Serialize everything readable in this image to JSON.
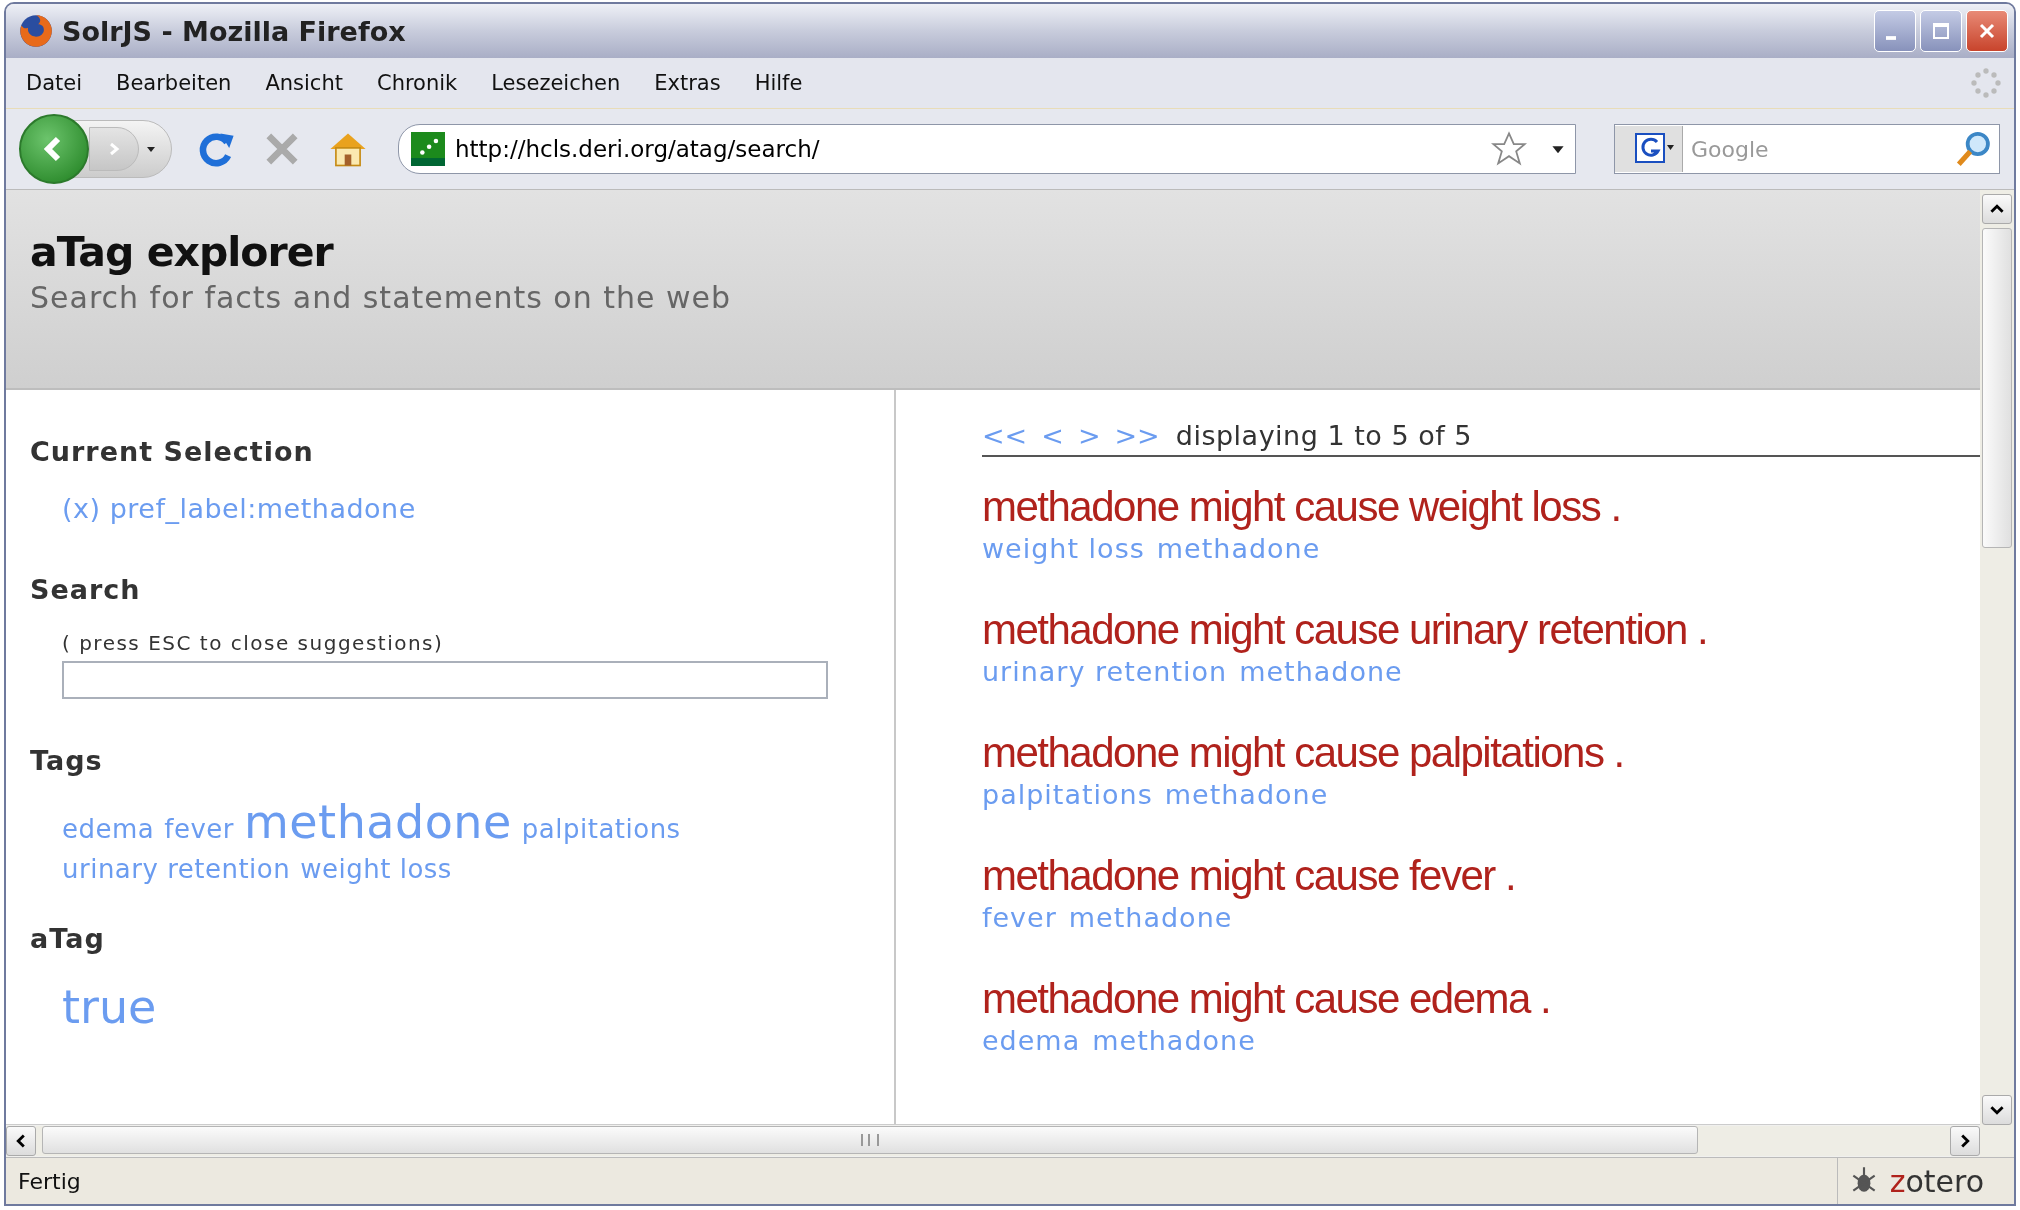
{
  "window": {
    "title": "SolrJS - Mozilla Firefox"
  },
  "menu": [
    "Datei",
    "Bearbeiten",
    "Ansicht",
    "Chronik",
    "Lesezeichen",
    "Extras",
    "Hilfe"
  ],
  "address_bar": {
    "value": "http://hcls.deri.org/atag/search/"
  },
  "search_bar": {
    "placeholder": "Google"
  },
  "page": {
    "title": "aTag explorer",
    "subtitle": "Search for facts and statements on the web",
    "sidebar": {
      "current_selection": {
        "heading": "Current Selection",
        "items": [
          "(x) pref_label:methadone"
        ]
      },
      "search": {
        "heading": "Search",
        "hint": "( press ESC to close suggestions)"
      },
      "tags": {
        "heading": "Tags",
        "items": [
          {
            "label": "edema",
            "kind": "normal"
          },
          {
            "label": "fever",
            "kind": "normal"
          },
          {
            "label": "methadone",
            "kind": "large"
          },
          {
            "label": "palpitations",
            "kind": "normal"
          },
          {
            "label": "urinary retention",
            "kind": "normal"
          },
          {
            "label": "weight loss",
            "kind": "normal"
          }
        ]
      },
      "atag": {
        "heading": "aTag",
        "items": [
          "true"
        ]
      }
    },
    "pager": {
      "links": [
        "<<",
        "<",
        ">",
        ">>"
      ],
      "text": "displaying 1 to 5 of 5"
    },
    "results": [
      {
        "title": "methadone might cause weight loss .",
        "tags": [
          "weight loss",
          "methadone"
        ]
      },
      {
        "title": "methadone might cause urinary retention .",
        "tags": [
          "urinary retention",
          "methadone"
        ]
      },
      {
        "title": "methadone might cause palpitations .",
        "tags": [
          "palpitations",
          "methadone"
        ]
      },
      {
        "title": "methadone might cause fever .",
        "tags": [
          "fever",
          "methadone"
        ]
      },
      {
        "title": "methadone might cause edema .",
        "tags": [
          "edema",
          "methadone"
        ]
      }
    ]
  },
  "status_bar": {
    "text": "Fertig",
    "addon": "zotero"
  }
}
